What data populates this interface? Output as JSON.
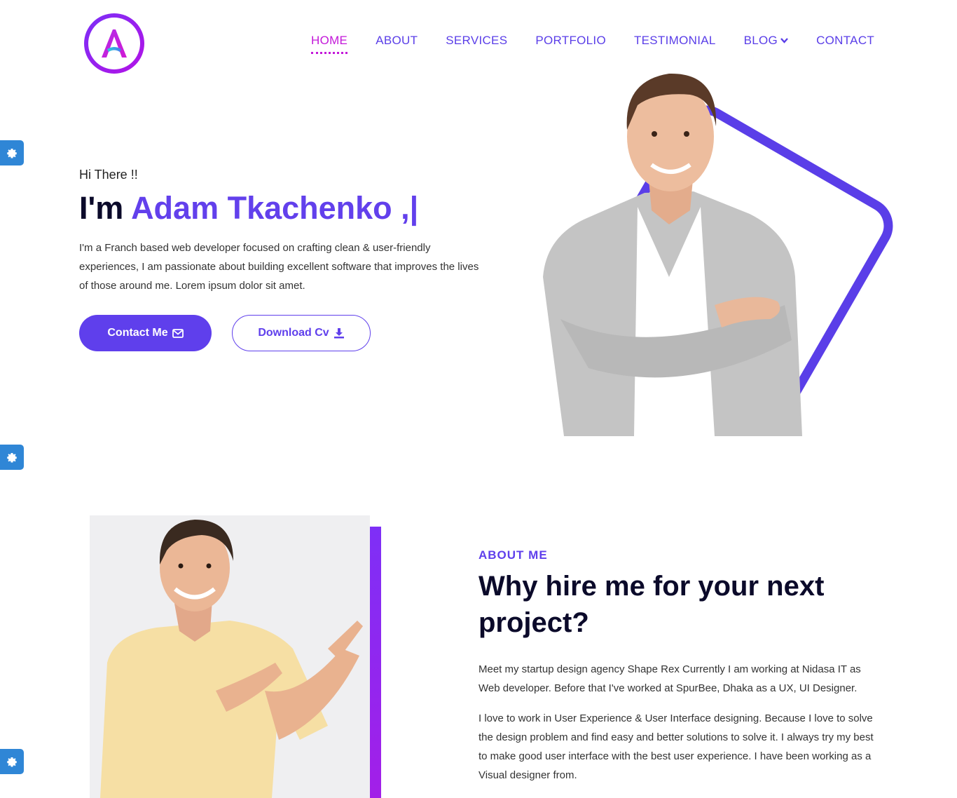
{
  "brand": {
    "logo_letter": "A",
    "accent": "#5f3fec",
    "highlight": "#c318d9"
  },
  "nav": {
    "items": [
      {
        "label": "HOME",
        "active": true
      },
      {
        "label": "ABOUT"
      },
      {
        "label": "SERVICES"
      },
      {
        "label": "PORTFOLIO"
      },
      {
        "label": "TESTIMONIAL"
      },
      {
        "label": "BLOG",
        "icon": "chevron-down-icon"
      },
      {
        "label": "CONTACT"
      }
    ]
  },
  "settings_tabs": {
    "icon": "gear-icon",
    "count": 3
  },
  "hero": {
    "greeting": "Hi There !!",
    "title_prefix": "I'm ",
    "name": "Adam Tkachenko ,|",
    "description": "I'm a Franch based web developer focused on crafting clean & user-friendly experiences, I am passionate about building excellent software that improves the lives of those around me. Lorem ipsum dolor sit amet.",
    "contact_button": "Contact Me",
    "contact_icon": "envelope-icon",
    "download_button": "Download Cv",
    "download_icon": "download-icon"
  },
  "about": {
    "kicker": "ABOUT ME",
    "title": "Why hire me for your next project?",
    "paragraph_1": "Meet my startup design agency Shape Rex Currently I am working at Nidasa IT as Web developer. Before that I've worked at SpurBee, Dhaka as a UX, UI Designer.",
    "paragraph_2": "I love to work in User Experience & User Interface designing. Because I love to solve the design problem and find easy and better solutions to solve it. I always try my best to make good user interface with the best user experience. I have been working as a Visual designer from."
  }
}
